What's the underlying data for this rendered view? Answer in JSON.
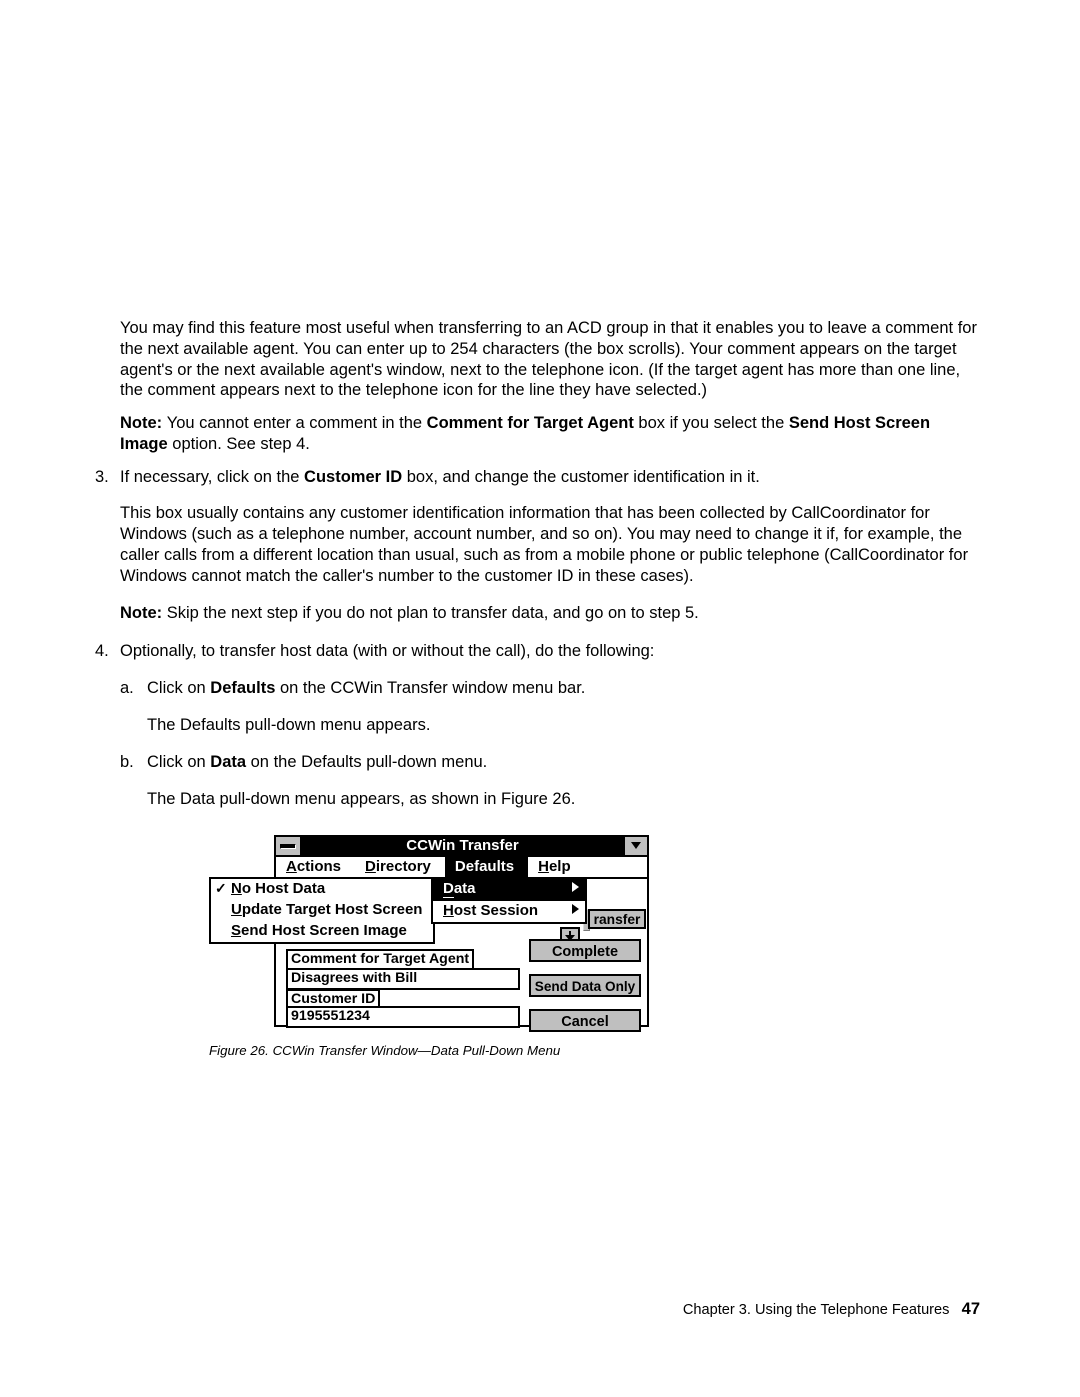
{
  "para_acd": "You may find this feature most useful when transferring to an ACD group in that it enables you to leave a comment for the next available agent.  You can enter up to 254 characters (the box scrolls).  Your comment appears on the target agent's or the next available agent's window, next to the telephone icon.  (If the target agent has more than one line, the comment appears next to the telephone icon for the line they have selected.)",
  "note1_pre": "Note:  ",
  "note1_a": "You cannot enter a comment in the ",
  "note1_b": "Comment for Target Agent",
  "note1_c": " box if you select the ",
  "note1_d": "Send Host Screen Image",
  "note1_e": " option.  See step 4.",
  "step3_marker": "3.",
  "step3_a": "If necessary, click on the ",
  "step3_b": "Customer ID",
  "step3_c": " box, and change the customer identification in it.",
  "step3_body": "This box usually contains any customer identification information that has been collected by CallCoordinator for Windows (such as a telephone number, account number, and so on).  You may need to change it if, for example, the caller calls from a different location than usual, such as from a mobile phone or public telephone (CallCoordinator for Windows cannot match the caller's number to the customer ID in these cases).",
  "note2_pre": "Note:  ",
  "note2_txt": "Skip the next step if you do not plan to transfer data, and go on to step 5.",
  "step4_marker": "4.",
  "step4_txt": "Optionally, to transfer host data (with or without the call), do the following:",
  "step4a_marker": "a.",
  "step4a_a": "Click on ",
  "step4a_b": "Defaults",
  "step4a_c": " on the CCWin Transfer window menu bar.",
  "step4a_body": "The Defaults pull-down menu appears.",
  "step4b_marker": "b.",
  "step4b_a": "Click on ",
  "step4b_b": "Data",
  "step4b_c": " on the Defaults pull-down menu.",
  "step4b_body": "The Data pull-down menu appears, as shown in Figure  26.",
  "caption": "Figure  26.  CCWin Transfer Window—Data Pull-Down Menu",
  "footer_txt": "Chapter 3.  Using the Telephone Features",
  "footer_pn": "47",
  "win": {
    "title": "CCWin Transfer",
    "menu": {
      "actions": {
        "u": "A",
        "rest": "ctions"
      },
      "directory": {
        "u": "D",
        "rest": "irectory"
      },
      "defaults": "Defaults",
      "help": {
        "u": "H",
        "rest": "elp"
      }
    },
    "popup1": {
      "r1_u": "N",
      "r1_rest": "o Host Data",
      "r2_u": "U",
      "r2_rest": "pdate Target Host Screen",
      "r3_u": "S",
      "r3_rest": "end Host Screen Image"
    },
    "popup2": {
      "r1_u": "D",
      "r1_rest": "ata",
      "r2_u": "H",
      "r2_rest": "ost Session"
    },
    "transfer_label": "ransfer",
    "buttons": {
      "complete": "Complete",
      "send": "Send Data Only",
      "cancel": "Cancel"
    },
    "comment_lbl": "Comment for Target Agent",
    "comment_val": "Disagrees with Bill",
    "custid_lbl": "Customer ID",
    "custid_val": "9195551234"
  }
}
